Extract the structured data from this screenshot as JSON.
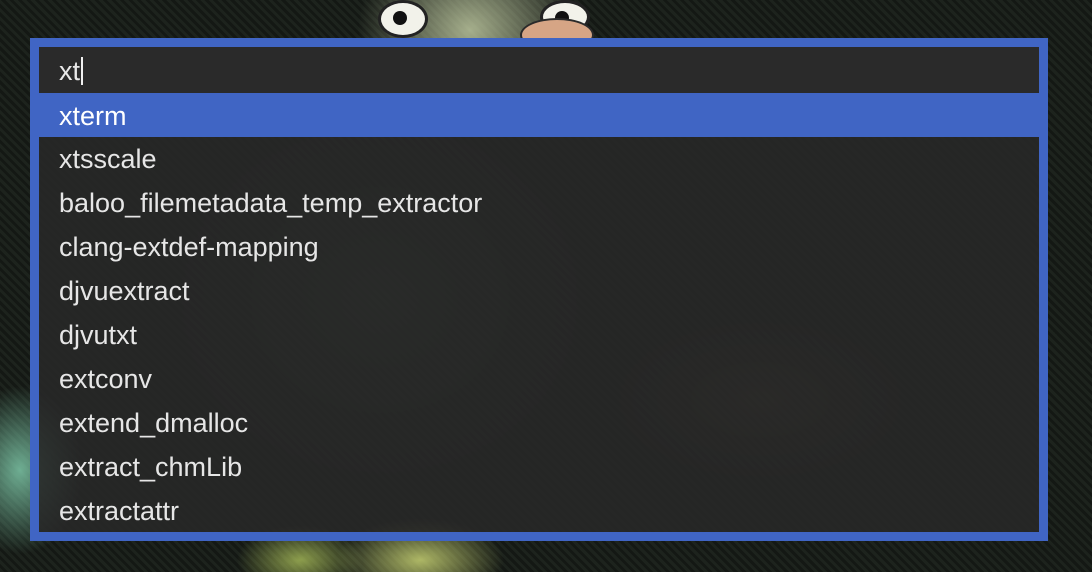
{
  "launcher": {
    "query": "xt",
    "selected_index": 0,
    "results": [
      "xterm",
      "xtsscale",
      "baloo_filemetadata_temp_extractor",
      "clang-extdef-mapping",
      "djvuextract",
      "djvutxt",
      "extconv",
      "extend_dmalloc",
      "extract_chmLib",
      "extractattr"
    ]
  },
  "colors": {
    "accent": "#4065c4",
    "panel": "#2a2a2a",
    "text": "#e6e6e6"
  }
}
